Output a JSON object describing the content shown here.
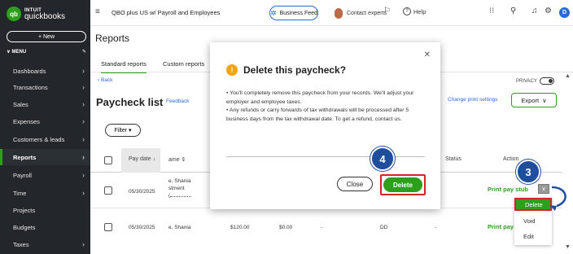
{
  "sidebar": {
    "logo_small": "INTUIT",
    "logo_big": "quickbooks",
    "logo_mark": "qb",
    "new_label": "+ New",
    "menu_label": "MENU",
    "items": [
      {
        "label": "Dashboards"
      },
      {
        "label": "Transactions"
      },
      {
        "label": "Sales"
      },
      {
        "label": "Expenses"
      },
      {
        "label": "Customers & leads"
      },
      {
        "label": "Reports"
      },
      {
        "label": "Payroll"
      },
      {
        "label": "Time"
      },
      {
        "label": "Projects"
      },
      {
        "label": "Budgets"
      },
      {
        "label": "Taxes"
      }
    ]
  },
  "topbar": {
    "company": "QBO plus US w/ Payroll and Employees",
    "business_feed": "Business Feed",
    "contact_experts": "Contact experts",
    "help": "Help",
    "user_initial": "D"
  },
  "page": {
    "title": "Reports",
    "tabs": [
      {
        "label": "Standard reports"
      },
      {
        "label": "Custom reports"
      }
    ],
    "back": "Back",
    "report_title": "Paycheck list",
    "feedback": "Feedback",
    "filter": "Filter",
    "privacy": "PRIVACY",
    "change_print": "Change print settings",
    "export": "Export"
  },
  "table": {
    "columns": {
      "pay_date": "Pay date",
      "name": "ame",
      "status": "Status",
      "action": "Action"
    },
    "rows": [
      {
        "date": "05/30/2025",
        "name_line1": "e, Shania",
        "name_line2": "stment",
        "name_line3": "(",
        "gross": "",
        "net": "",
        "memo": "",
        "status": "",
        "action": "Print pay stub"
      },
      {
        "date": "05/30/2025",
        "name_line1": "e, Shania",
        "gross": "$120.00",
        "net": "$0.00",
        "dash1": "-",
        "method": "DD",
        "dash2": "-",
        "action": "Print pay"
      }
    ]
  },
  "dropdown": {
    "items": [
      {
        "label": "Delete"
      },
      {
        "label": "Void"
      },
      {
        "label": "Edit"
      }
    ]
  },
  "modal": {
    "title": "Delete this paycheck?",
    "body_line1": "You'll completely remove this paycheck from your records. We'll adjust your employer and employee taxes.",
    "body_line2": "Any refunds or carry forwards of tax withdrawals will be processed after 5 business days from the tax withdrawal date. To get a refund, contact us.",
    "cancel": "Close",
    "confirm": "Delete"
  },
  "steps": {
    "step_delete_modal": "4",
    "step_dropdown": "3"
  },
  "colors": {
    "accent_green": "#2ca01c",
    "highlight_red": "#d6232a",
    "step_blue": "#1f4e9c",
    "sidebar_bg": "#23272b",
    "link_blue": "#2b6cd4"
  }
}
